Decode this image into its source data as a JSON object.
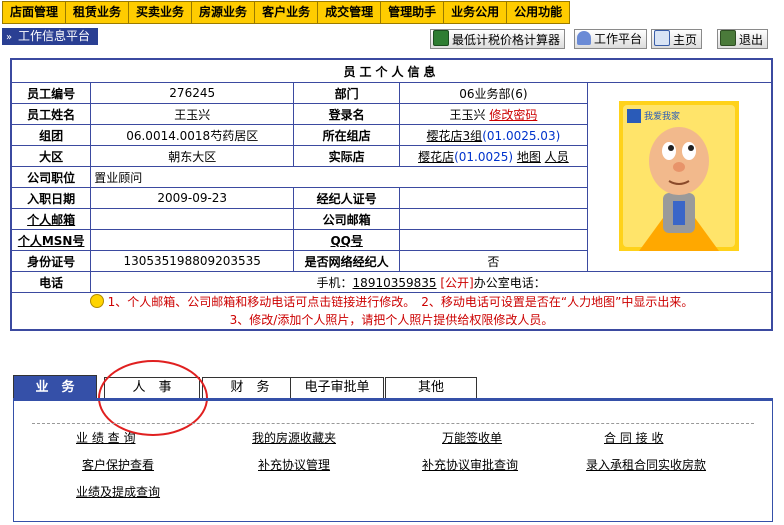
{
  "menu": [
    "店面管理",
    "租赁业务",
    "买卖业务",
    "房源业务",
    "客户业务",
    "成交管理",
    "管理助手",
    "业务公用",
    "公用功能"
  ],
  "platform_label": "工作信息平台",
  "platform_arrows": "»",
  "toolbar": {
    "calc": "最低计税价格计算器",
    "workbench": "工作平台",
    "home": "主页",
    "logout": "退出"
  },
  "info": {
    "title": "员工个人信息",
    "labels": {
      "emp_no": "员工编号",
      "dept": "部门",
      "emp_name": "员工姓名",
      "login": "登录名",
      "group": "组团",
      "store_group": "所在组店",
      "region": "大区",
      "actual_store": "实际店",
      "position": "公司职位",
      "join_date": "入职日期",
      "agent_cert": "经纪人证号",
      "email": "个人邮箱",
      "company_email": "公司邮箱",
      "msn": "个人MSN号",
      "qq": "QQ号",
      "id_card": "身份证号",
      "is_net_agent": "是否网络经纪人",
      "phone": "电话"
    },
    "values": {
      "emp_no": "276245",
      "dept": "06业务部(6)",
      "emp_name": "王玉兴",
      "login_name": "王玉兴",
      "change_pwd": "修改密码",
      "group": "06.0014.0018芍药居区",
      "store_group_link": "樱花店3组",
      "store_group_code": "(01.0025.03)",
      "region": "朝东大区",
      "actual_store_link": "樱花店",
      "actual_store_code": "(01.0025)",
      "map_link": "地图",
      "people_link": "人员",
      "position": "置业顾问",
      "join_date": "2009-09-23",
      "id_card": "130535198809203535",
      "is_net_agent": "否",
      "phone_prefix": "手机：",
      "mobile": "18910359835",
      "public": "[公开]",
      "office_phone": "办公室电话："
    },
    "photo_logo": "我爱我家",
    "notice1": "1、个人邮箱、公司邮箱和移动电话可点击链接进行修改。　2、移动电话可设置是否在“人力地图”中显示出来。",
    "notice2": "3、修改/添加个人照片，请把个人照片提供给权限修改人员。"
  },
  "tabs": [
    "业　务",
    "人　事",
    "财　务",
    "电子审批单",
    "其他"
  ],
  "links": {
    "r1": [
      "业 绩 查 询",
      "我的房源收藏夹",
      "万能签收单",
      "合 同 接 收"
    ],
    "r2": [
      "客户保护查看",
      "补充协议管理",
      "补充协议审批查询",
      "录入承租合同实收房款"
    ],
    "r3": [
      "业绩及提成查询"
    ]
  },
  "colors": {
    "menu_bg": "#FFCC00",
    "accent": "#3550A8",
    "red": "#CC0000"
  }
}
